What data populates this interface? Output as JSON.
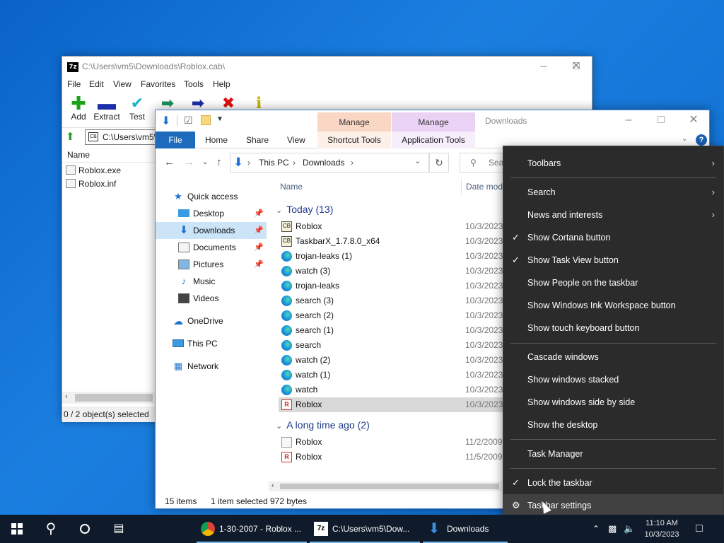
{
  "zip": {
    "title": "C:\\Users\\vm5\\Downloads\\Roblox.cab\\",
    "app_icon": "7z",
    "menu": [
      "File",
      "Edit",
      "View",
      "Favorites",
      "Tools",
      "Help"
    ],
    "toolbar": [
      {
        "label": "Add",
        "icon": "plus-icon",
        "color": "#1aa31a"
      },
      {
        "label": "Extract",
        "icon": "minus-icon",
        "color": "#1c2fa8"
      },
      {
        "label": "Test",
        "icon": "check-icon",
        "color": "#12b5c8"
      },
      {
        "label": "",
        "icon": "copy-arrow-icon",
        "color": "#1a8f5a"
      },
      {
        "label": "",
        "icon": "move-arrow-icon",
        "color": "#1c2fa8"
      },
      {
        "label": "",
        "icon": "delete-icon",
        "color": "#e01010"
      },
      {
        "label": "",
        "icon": "info-icon",
        "color": "#c7b000"
      }
    ],
    "address": "C:\\Users\\vm5\\",
    "column_name": "Name",
    "files": [
      "Roblox.exe",
      "Roblox.inf"
    ],
    "status": "0 / 2 object(s) selected"
  },
  "explorer": {
    "window_title": "Downloads",
    "manage_a": "Manage",
    "manage_b": "Manage",
    "tabs": {
      "file": "File",
      "home": "Home",
      "share": "Share",
      "view": "View",
      "shortcut_tools": "Shortcut Tools",
      "application_tools": "Application Tools"
    },
    "breadcrumb": [
      "This PC",
      "Downloads"
    ],
    "search_placeholder": "Sear",
    "nav": [
      {
        "label": "Quick access",
        "icon": "star-icon",
        "pinned": false
      },
      {
        "label": "Desktop",
        "icon": "desktop-icon",
        "pinned": true
      },
      {
        "label": "Downloads",
        "icon": "download-icon",
        "pinned": true,
        "selected": true
      },
      {
        "label": "Documents",
        "icon": "documents-icon",
        "pinned": true
      },
      {
        "label": "Pictures",
        "icon": "pictures-icon",
        "pinned": true
      },
      {
        "label": "Music",
        "icon": "music-icon",
        "pinned": false
      },
      {
        "label": "Videos",
        "icon": "videos-icon",
        "pinned": false
      },
      {
        "label": "OneDrive",
        "icon": "cloud-icon",
        "pinned": false
      },
      {
        "label": "This PC",
        "icon": "computer-icon",
        "pinned": false
      },
      {
        "label": "Network",
        "icon": "network-icon",
        "pinned": false
      }
    ],
    "col_name": "Name",
    "col_date": "Date modi",
    "group_today": "Today (13)",
    "group_old": "A long time ago (2)",
    "today_files": [
      {
        "name": "Roblox",
        "date": "10/3/2023",
        "icon": "cab"
      },
      {
        "name": "TaskbarX_1.7.8.0_x64",
        "date": "10/3/2023",
        "icon": "cab"
      },
      {
        "name": "trojan-leaks (1)",
        "date": "10/3/2023",
        "icon": "edge"
      },
      {
        "name": "watch (3)",
        "date": "10/3/2023",
        "icon": "edge"
      },
      {
        "name": "trojan-leaks",
        "date": "10/3/2023",
        "icon": "edge"
      },
      {
        "name": "search (3)",
        "date": "10/3/2023",
        "icon": "edge"
      },
      {
        "name": "search (2)",
        "date": "10/3/2023",
        "icon": "edge"
      },
      {
        "name": "search (1)",
        "date": "10/3/2023",
        "icon": "edge"
      },
      {
        "name": "search",
        "date": "10/3/2023",
        "icon": "edge"
      },
      {
        "name": "watch (2)",
        "date": "10/3/2023",
        "icon": "edge"
      },
      {
        "name": "watch (1)",
        "date": "10/3/2023",
        "icon": "edge"
      },
      {
        "name": "watch",
        "date": "10/3/2023",
        "icon": "edge"
      },
      {
        "name": "Roblox",
        "date": "10/3/2023",
        "icon": "robx",
        "selected": true
      }
    ],
    "old_files": [
      {
        "name": "Roblox",
        "date": "11/2/2009",
        "icon": "inf"
      },
      {
        "name": "Roblox",
        "date": "11/5/2009",
        "icon": "robx"
      }
    ],
    "status_items": "15 items",
    "status_selected": "1 item selected",
    "status_size": "972 bytes"
  },
  "context_menu": {
    "items": [
      {
        "label": "Toolbars",
        "submenu": true,
        "checked": false
      },
      {
        "label": "Search",
        "submenu": true,
        "checked": false
      },
      {
        "label": "News and interests",
        "submenu": true,
        "checked": false
      },
      {
        "label": "Show Cortana button",
        "submenu": false,
        "checked": true
      },
      {
        "label": "Show Task View button",
        "submenu": false,
        "checked": true
      },
      {
        "label": "Show People on the taskbar",
        "submenu": false,
        "checked": false
      },
      {
        "label": "Show Windows Ink Workspace button",
        "submenu": false,
        "checked": false
      },
      {
        "label": "Show touch keyboard button",
        "submenu": false,
        "checked": false
      },
      {
        "label": "Cascade windows",
        "submenu": false,
        "checked": false
      },
      {
        "label": "Show windows stacked",
        "submenu": false,
        "checked": false
      },
      {
        "label": "Show windows side by side",
        "submenu": false,
        "checked": false
      },
      {
        "label": "Show the desktop",
        "submenu": false,
        "checked": false
      },
      {
        "label": "Task Manager",
        "submenu": false,
        "checked": false
      },
      {
        "label": "Lock the taskbar",
        "submenu": false,
        "checked": true
      },
      {
        "label": "Taskbar settings",
        "submenu": false,
        "checked": false,
        "icon": "gear-icon"
      }
    ]
  },
  "taskbar": {
    "apps": [
      {
        "label": "1-30-2007 - Roblox ...",
        "icon": "chrome-icon"
      },
      {
        "label": "C:\\Users\\vm5\\Dow...",
        "icon": "7zip-icon"
      },
      {
        "label": "Downloads",
        "icon": "download-icon"
      }
    ],
    "clock_time": "11:10 AM",
    "clock_date": "10/3/2023"
  }
}
